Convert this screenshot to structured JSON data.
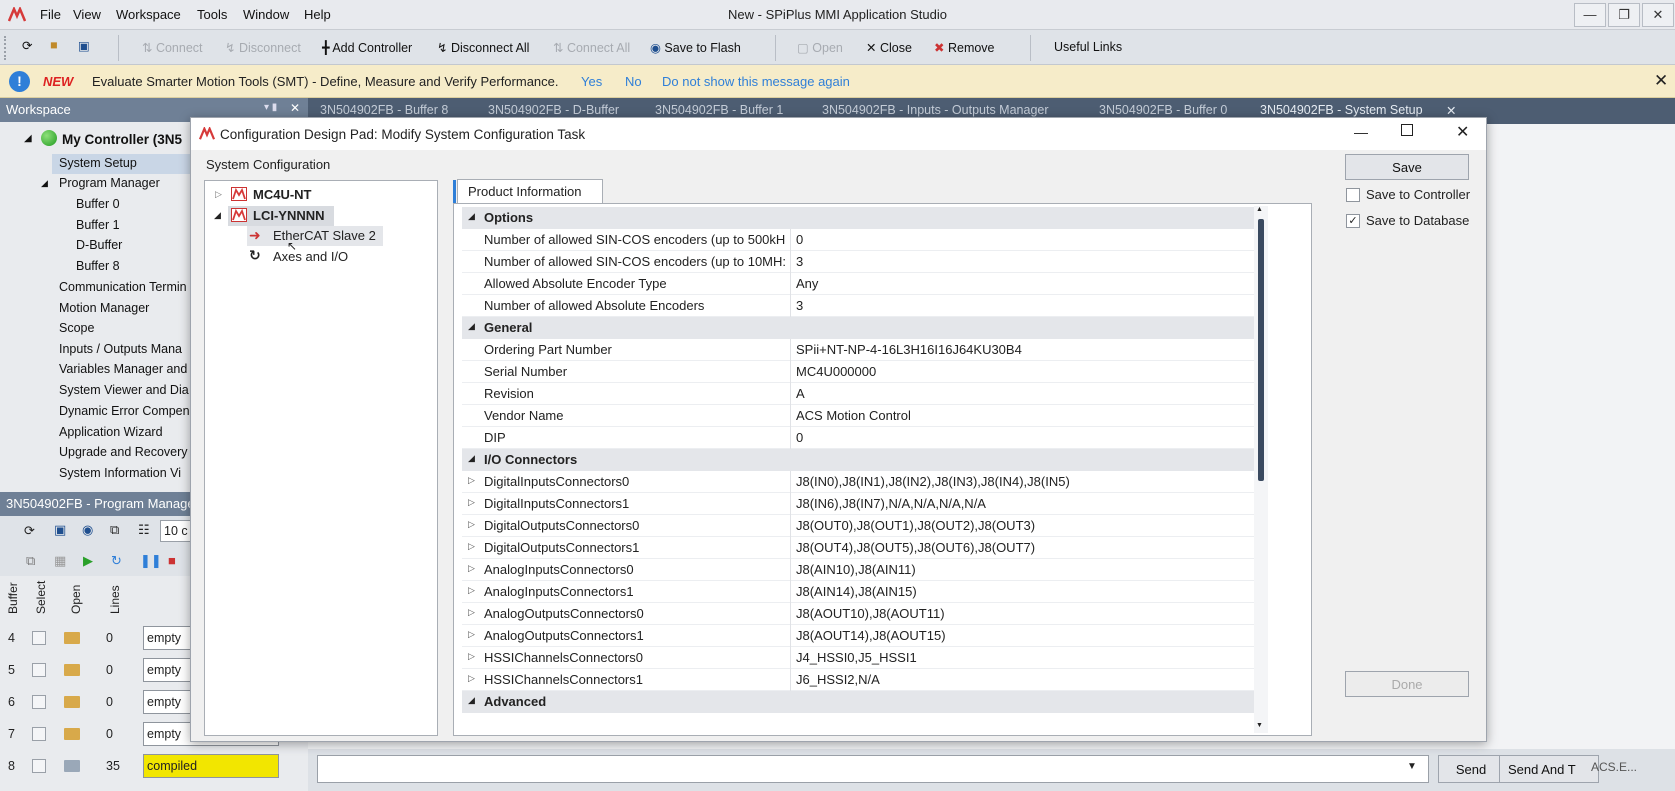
{
  "app": {
    "title": "New - SPiPlus MMI Application Studio",
    "menu": [
      "File",
      "View",
      "Workspace",
      "Tools",
      "Window",
      "Help"
    ]
  },
  "toolbar": {
    "connect": "Connect",
    "disconnect": "Disconnect",
    "add_controller": "Add Controller",
    "disconnect_all": "Disconnect All",
    "connect_all": "Connect All",
    "save_to_flash": "Save to Flash",
    "open": "Open",
    "close": "Close",
    "remove": "Remove",
    "useful_links": "Useful Links"
  },
  "notification": {
    "new_label": "NEW",
    "message": "Evaluate Smarter Motion Tools (SMT) - Define, Measure and Verify Performance.",
    "yes": "Yes",
    "no": "No",
    "dont_show": "Do not show this message again"
  },
  "workspace": {
    "title": "Workspace",
    "root": "My Controller (3N5",
    "items": [
      "System Setup",
      "Program Manager",
      "Buffer 0",
      "Buffer 1",
      "D-Buffer",
      "Buffer 8",
      "Communication Termin",
      "Motion Manager",
      "Scope",
      "Inputs / Outputs Mana",
      "Variables Manager and",
      "System Viewer and Dia",
      "Dynamic Error Compen",
      "Application Wizard",
      "Upgrade and Recovery",
      "System Information Vi"
    ]
  },
  "program_manager": {
    "title": "3N504902FB - Program Manage",
    "combo": "10 c",
    "columns": [
      "Buffer",
      "Select",
      "Open",
      "Lines"
    ],
    "rows": [
      {
        "buffer": "4",
        "lines": "0",
        "status": "empty"
      },
      {
        "buffer": "5",
        "lines": "0",
        "status": "empty"
      },
      {
        "buffer": "6",
        "lines": "0",
        "status": "empty"
      },
      {
        "buffer": "7",
        "lines": "0",
        "status": "empty"
      },
      {
        "buffer": "8",
        "lines": "35",
        "status": "compiled"
      }
    ]
  },
  "doc_tabs": [
    "3N504902FB - Buffer 8",
    "3N504902FB - D-Buffer",
    "3N504902FB - Buffer 1",
    "3N504902FB - Inputs - Outputs Manager",
    "3N504902FB - Buffer 0",
    "3N504902FB - System Setup"
  ],
  "send_bar": {
    "send": "Send",
    "send_and": "Send And T",
    "acs": "ACS.E..."
  },
  "dialog": {
    "title": "Configuration Design Pad: Modify System Configuration Task",
    "group_label": "System Configuration",
    "tree": {
      "node1": "MC4U-NT",
      "node2": "LCI-YNNNN",
      "child1": "EtherCAT Slave 2",
      "child2": "Axes and I/O"
    },
    "tab": "Product Information",
    "categories": {
      "options": "Options",
      "general": "General",
      "io": "I/O Connectors",
      "advanced": "Advanced"
    },
    "options_rows": [
      {
        "k": "Number of allowed SIN-COS encoders (up to 500kH",
        "v": "0"
      },
      {
        "k": "Number of allowed SIN-COS encoders (up to 10MH:",
        "v": "3"
      },
      {
        "k": "Allowed Absolute Encoder Type",
        "v": "Any"
      },
      {
        "k": "Number of allowed Absolute Encoders",
        "v": "3"
      }
    ],
    "general_rows": [
      {
        "k": "Ordering Part Number",
        "v": "SPii+NT-NP-4-16L3H16I16J64KU30B4"
      },
      {
        "k": "Serial Number",
        "v": "MC4U000000"
      },
      {
        "k": "Revision",
        "v": "A"
      },
      {
        "k": "Vendor Name",
        "v": "ACS Motion Control"
      },
      {
        "k": "DIP",
        "v": "0"
      }
    ],
    "io_rows": [
      {
        "k": "DigitalInputsConnectors0",
        "v": "J8(IN0),J8(IN1),J8(IN2),J8(IN3),J8(IN4),J8(IN5)"
      },
      {
        "k": "DigitalInputsConnectors1",
        "v": "J8(IN6),J8(IN7),N/A,N/A,N/A,N/A"
      },
      {
        "k": "DigitalOutputsConnectors0",
        "v": "J8(OUT0),J8(OUT1),J8(OUT2),J8(OUT3)"
      },
      {
        "k": "DigitalOutputsConnectors1",
        "v": "J8(OUT4),J8(OUT5),J8(OUT6),J8(OUT7)"
      },
      {
        "k": "AnalogInputsConnectors0",
        "v": "J8(AIN10),J8(AIN11)"
      },
      {
        "k": "AnalogInputsConnectors1",
        "v": "J8(AIN14),J8(AIN15)"
      },
      {
        "k": "AnalogOutputsConnectors0",
        "v": "J8(AOUT10),J8(AOUT11)"
      },
      {
        "k": "AnalogOutputsConnectors1",
        "v": "J8(AOUT14),J8(AOUT15)"
      },
      {
        "k": "HSSIChannelsConnectors0",
        "v": "J4_HSSI0,J5_HSSI1"
      },
      {
        "k": "HSSIChannelsConnectors1",
        "v": "J6_HSSI2,N/A"
      }
    ],
    "save": "Save",
    "save_controller": "Save to Controller",
    "save_database": "Save to Database",
    "done": "Done"
  },
  "colors": {
    "accent": "#2f7fd8",
    "header": "#6f8096",
    "tabstrip": "#4d5d72",
    "compiled": "#f2e600",
    "notif_bg": "#f6ecc9"
  }
}
